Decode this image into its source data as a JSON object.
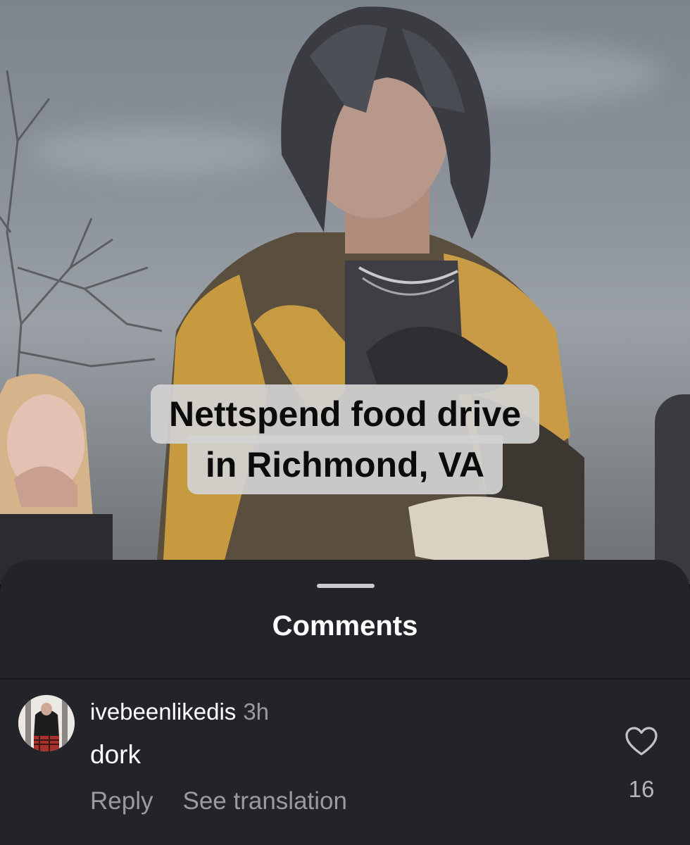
{
  "video": {
    "caption_lines": [
      "Nettspend food drive",
      "in Richmond, VA"
    ]
  },
  "comments_sheet": {
    "title": "Comments",
    "comments": [
      {
        "username": "ivebeenlikedis",
        "time": "3h",
        "text": "dork",
        "reply_label": "Reply",
        "translate_label": "See translation",
        "like_count": "16",
        "like_icon": "heart-outline-icon"
      }
    ]
  },
  "colors": {
    "sheet_background": "#232429",
    "primary_text": "#ffffff",
    "secondary_text": "#9a9ba0",
    "caption_background": "#d2d2d2"
  }
}
